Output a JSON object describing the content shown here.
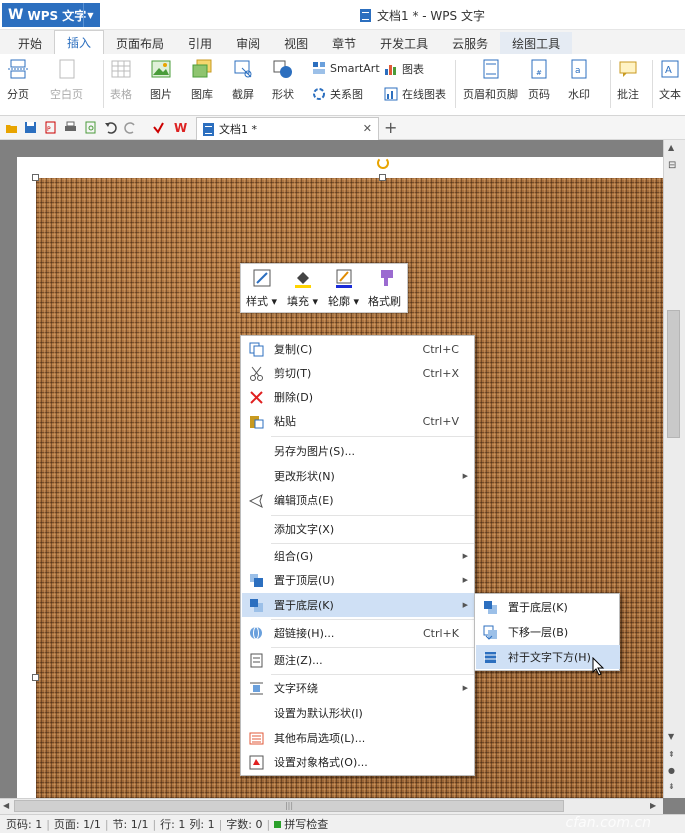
{
  "app": {
    "name": "WPS 文字",
    "window_title": "文档1 * - WPS 文字"
  },
  "ribbon_tabs": [
    "开始",
    "插入",
    "页面布局",
    "引用",
    "审阅",
    "视图",
    "章节",
    "开发工具",
    "云服务",
    "绘图工具"
  ],
  "ribbon": {
    "fenye": "分页",
    "kongbaiye": "空白页",
    "biaoge": "表格",
    "tupian": "图片",
    "tuku": "图库",
    "jietu": "截屏",
    "xingzhuang": "形状",
    "smartart": "SmartArt",
    "tubiao": "图表",
    "guanxitu": "关系图",
    "zaixiantubiao": "在线图表",
    "yemeiyejiao": "页眉和页脚",
    "yema": "页码",
    "shuiyin": "水印",
    "pizhu": "批注",
    "wenben": "文本"
  },
  "doc_tab": {
    "label": "文档1 *"
  },
  "mini_toolbar": {
    "style": "样式",
    "fill": "填充",
    "outline": "轮廓",
    "painter": "格式刷"
  },
  "context_menu": {
    "copy": {
      "label": "复制(C)",
      "shortcut": "Ctrl+C"
    },
    "cut": {
      "label": "剪切(T)",
      "shortcut": "Ctrl+X"
    },
    "delete": {
      "label": "删除(D)"
    },
    "paste": {
      "label": "粘贴",
      "shortcut": "Ctrl+V"
    },
    "save_as_image": {
      "label": "另存为图片(S)..."
    },
    "change_shape": {
      "label": "更改形状(N)"
    },
    "edit_points": {
      "label": "编辑顶点(E)"
    },
    "add_text": {
      "label": "添加文字(X)"
    },
    "group": {
      "label": "组合(G)"
    },
    "bring_to_front": {
      "label": "置于顶层(U)"
    },
    "send_to_back": {
      "label": "置于底层(K)"
    },
    "hyperlink": {
      "label": "超链接(H)...",
      "shortcut": "Ctrl+K"
    },
    "caption": {
      "label": "题注(Z)..."
    },
    "text_wrap": {
      "label": "文字环绕"
    },
    "set_default": {
      "label": "设置为默认形状(I)"
    },
    "more_layout": {
      "label": "其他布局选项(L)..."
    },
    "format_object": {
      "label": "设置对象格式(O)..."
    }
  },
  "submenu": {
    "send_to_back": "置于底层(K)",
    "send_backward": "下移一层(B)",
    "behind_text": "衬于文字下方(H)"
  },
  "status": {
    "page_num": "页码: 1",
    "pages": "页面: 1/1",
    "section": "节: 1/1",
    "row": "行: 1",
    "col": "列: 1",
    "words": "字数: 0",
    "spell": "拼写检查"
  },
  "watermark": "cfan.com.cn",
  "colors": {
    "accent": "#2c6fbf",
    "menu_highlight": "#cfe0f5",
    "burlap": "#a36b3a"
  }
}
